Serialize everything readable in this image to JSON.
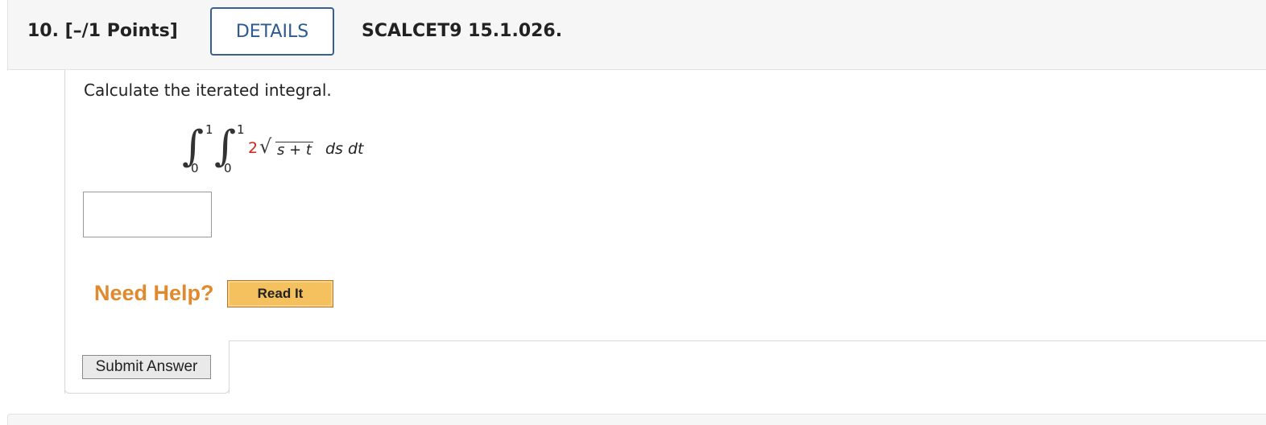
{
  "question": {
    "number_label": "10.  [–/1 Points]",
    "details_label": "DETAILS",
    "problem_id": "SCALCET9 15.1.026."
  },
  "prompt": "Calculate the iterated integral.",
  "integral": {
    "outer_upper": "1",
    "outer_lower": "0",
    "inner_upper": "1",
    "inner_lower": "0",
    "coefficient": "2",
    "radicand": "s + t",
    "differentials": "ds dt",
    "coefficient_color": "#d6221c"
  },
  "answer": {
    "value": "",
    "placeholder": ""
  },
  "help": {
    "label": "Need Help?",
    "read_it_label": "Read It"
  },
  "submit_label": "Submit Answer",
  "colors": {
    "details_border": "#356091",
    "need_help": "#e18a2d",
    "read_it_bg": "#f4c15e"
  }
}
